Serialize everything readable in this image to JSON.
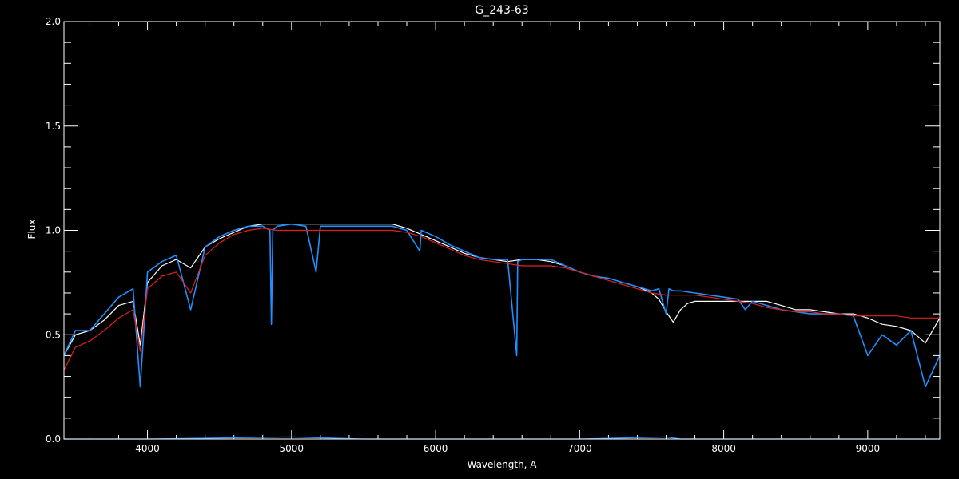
{
  "chart_data": {
    "type": "line",
    "title": "G_243-63",
    "xlabel": "Wavelength, A",
    "ylabel": "Flux",
    "xlim": [
      3420,
      9500
    ],
    "ylim": [
      0.0,
      2.0
    ],
    "x_ticks": [
      4000,
      5000,
      6000,
      7000,
      8000,
      9000
    ],
    "x_tick_labels": [
      "4000",
      "5000",
      "6000",
      "7000",
      "8000",
      "9000"
    ],
    "y_ticks": [
      0.0,
      0.5,
      1.0,
      1.5,
      2.0
    ],
    "y_tick_labels": [
      "0.0",
      "0.5",
      "1.0",
      "1.5",
      "2.0"
    ],
    "grid": false,
    "colors": {
      "background": "#000000",
      "axes": "#ffffff",
      "observed": "#ffffff",
      "observed_blue": "#1e90ff",
      "model": "#e02020",
      "error": "#1e90ff"
    },
    "series": [
      {
        "color": "#ffffff",
        "x": [
          3420,
          3500,
          3600,
          3700,
          3800,
          3900,
          3950,
          4000,
          4100,
          4200,
          4300,
          4400,
          4500,
          4600,
          4700,
          4800,
          4900,
          5000,
          5100,
          5200,
          5300,
          5400,
          5500,
          5600,
          5700,
          5800,
          5900,
          6000,
          6100,
          6200,
          6300,
          6400,
          6500,
          6600,
          6700,
          6800,
          6900,
          7000,
          7100,
          7200,
          7300,
          7400,
          7500,
          7550,
          7600,
          7650,
          7700,
          7750,
          7800,
          7900,
          8000,
          8100,
          8200,
          8300,
          8400,
          8500,
          8600,
          8700,
          8800,
          8900,
          9000,
          9100,
          9200,
          9300,
          9400,
          9500
        ],
        "y": [
          0.4,
          0.5,
          0.52,
          0.57,
          0.64,
          0.66,
          0.45,
          0.75,
          0.83,
          0.86,
          0.82,
          0.92,
          0.96,
          0.99,
          1.02,
          1.03,
          1.03,
          1.03,
          1.03,
          1.03,
          1.03,
          1.03,
          1.03,
          1.03,
          1.03,
          1.01,
          0.98,
          0.95,
          0.92,
          0.89,
          0.87,
          0.86,
          0.85,
          0.86,
          0.86,
          0.85,
          0.83,
          0.8,
          0.78,
          0.77,
          0.75,
          0.73,
          0.7,
          0.67,
          0.61,
          0.56,
          0.62,
          0.65,
          0.66,
          0.66,
          0.66,
          0.66,
          0.66,
          0.66,
          0.64,
          0.62,
          0.62,
          0.61,
          0.6,
          0.6,
          0.58,
          0.55,
          0.54,
          0.52,
          0.46,
          0.58
        ]
      },
      {
        "color": "#1e90ff",
        "x": [
          3420,
          3500,
          3600,
          3700,
          3800,
          3900,
          3950,
          4000,
          4100,
          4200,
          4300,
          4400,
          4500,
          4600,
          4700,
          4800,
          4850,
          4860,
          4870,
          4900,
          5000,
          5100,
          5170,
          5200,
          5300,
          5400,
          5500,
          5600,
          5700,
          5800,
          5890,
          5900,
          6000,
          6100,
          6200,
          6300,
          6400,
          6500,
          6563,
          6570,
          6600,
          6700,
          6800,
          6900,
          7000,
          7100,
          7200,
          7300,
          7400,
          7500,
          7550,
          7600,
          7620,
          7650,
          7700,
          7800,
          7900,
          8000,
          8100,
          8150,
          8200,
          8300,
          8400,
          8500,
          8600,
          8700,
          8800,
          8900,
          9000,
          9100,
          9200,
          9300,
          9400,
          9500
        ],
        "y": [
          0.4,
          0.52,
          0.52,
          0.6,
          0.68,
          0.72,
          0.25,
          0.8,
          0.85,
          0.88,
          0.62,
          0.92,
          0.97,
          1.0,
          1.02,
          1.02,
          1.0,
          0.55,
          1.0,
          1.02,
          1.03,
          1.02,
          0.8,
          1.02,
          1.02,
          1.02,
          1.02,
          1.02,
          1.02,
          1.0,
          0.9,
          1.0,
          0.97,
          0.93,
          0.9,
          0.87,
          0.86,
          0.86,
          0.4,
          0.85,
          0.86,
          0.86,
          0.86,
          0.83,
          0.8,
          0.78,
          0.77,
          0.75,
          0.73,
          0.71,
          0.72,
          0.6,
          0.72,
          0.71,
          0.71,
          0.7,
          0.69,
          0.68,
          0.67,
          0.62,
          0.66,
          0.64,
          0.62,
          0.61,
          0.6,
          0.6,
          0.6,
          0.59,
          0.4,
          0.5,
          0.45,
          0.52,
          0.25,
          0.4
        ]
      },
      {
        "color": "#e02020",
        "x": [
          3420,
          3500,
          3600,
          3700,
          3800,
          3900,
          3950,
          4000,
          4100,
          4200,
          4300,
          4400,
          4500,
          4600,
          4700,
          4800,
          4900,
          5000,
          5100,
          5200,
          5300,
          5400,
          5500,
          5600,
          5700,
          5800,
          5900,
          6000,
          6100,
          6200,
          6300,
          6400,
          6500,
          6600,
          6700,
          6800,
          6900,
          7000,
          7100,
          7200,
          7300,
          7400,
          7500,
          7600,
          7700,
          7800,
          7900,
          8000,
          8100,
          8200,
          8300,
          8400,
          8500,
          8600,
          8700,
          8800,
          8900,
          9000,
          9100,
          9200,
          9300,
          9400,
          9500
        ],
        "y": [
          0.33,
          0.44,
          0.47,
          0.52,
          0.58,
          0.62,
          0.42,
          0.72,
          0.78,
          0.8,
          0.7,
          0.88,
          0.94,
          0.98,
          1.0,
          1.01,
          1.0,
          1.0,
          1.0,
          1.0,
          1.0,
          1.0,
          1.0,
          1.0,
          1.0,
          0.99,
          0.97,
          0.94,
          0.91,
          0.88,
          0.86,
          0.85,
          0.84,
          0.83,
          0.83,
          0.83,
          0.82,
          0.8,
          0.78,
          0.76,
          0.74,
          0.72,
          0.7,
          0.69,
          0.69,
          0.69,
          0.68,
          0.67,
          0.66,
          0.65,
          0.63,
          0.62,
          0.61,
          0.61,
          0.6,
          0.6,
          0.59,
          0.59,
          0.59,
          0.59,
          0.58,
          0.58,
          0.58
        ]
      },
      {
        "color": "#1e90ff",
        "x": [
          3420,
          4000,
          5000,
          5500,
          6000,
          7000,
          7600,
          7700,
          8000,
          9000,
          9500
        ],
        "y": [
          0.0,
          0.0,
          0.01,
          0.0,
          0.0,
          0.0,
          0.01,
          0.0,
          0.0,
          0.0,
          0.0
        ]
      }
    ]
  }
}
